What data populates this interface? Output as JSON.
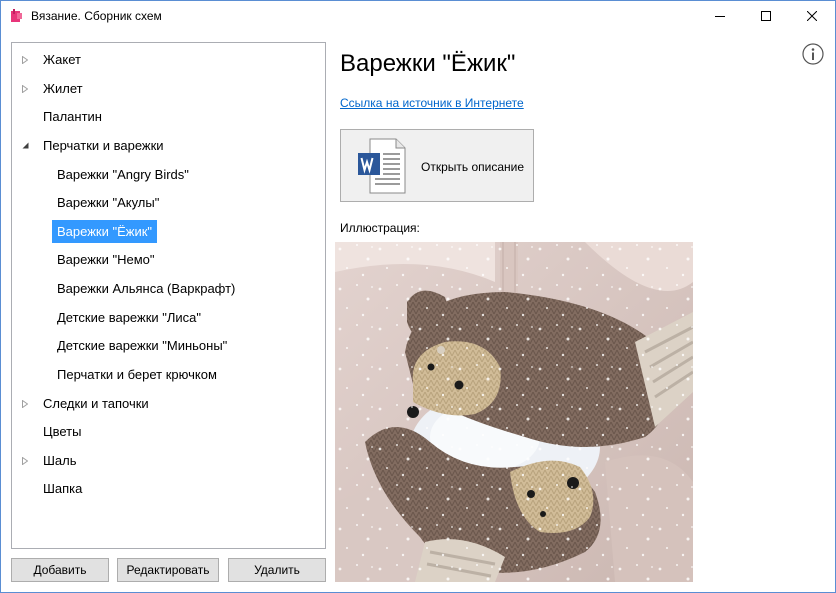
{
  "window": {
    "title": "Вязание. Сборник схем",
    "controls": [
      "minimize",
      "maximize",
      "close"
    ]
  },
  "tree": {
    "items": [
      {
        "label": "Жакет",
        "expandable": true,
        "expanded": false,
        "level": 0
      },
      {
        "label": "Жилет",
        "expandable": true,
        "expanded": false,
        "level": 0
      },
      {
        "label": "Палантин",
        "expandable": false,
        "level": 0
      },
      {
        "label": "Перчатки и варежки",
        "expandable": true,
        "expanded": true,
        "level": 0
      },
      {
        "label": "Варежки \"Angry Birds\"",
        "level": 1
      },
      {
        "label": "Варежки \"Акулы\"",
        "level": 1
      },
      {
        "label": "Варежки \"Ёжик\"",
        "level": 1,
        "selected": true
      },
      {
        "label": "Варежки \"Немо\"",
        "level": 1
      },
      {
        "label": "Варежки Альянса (Варкрафт)",
        "level": 1
      },
      {
        "label": "Детские варежки \"Лиса\"",
        "level": 1
      },
      {
        "label": "Детские варежки \"Миньоны\"",
        "level": 1
      },
      {
        "label": "Перчатки и берет крючком",
        "level": 1
      },
      {
        "label": "Следки и тапочки",
        "expandable": true,
        "expanded": false,
        "level": 0
      },
      {
        "label": "Цветы",
        "expandable": false,
        "level": 0
      },
      {
        "label": "Шаль",
        "expandable": true,
        "expanded": false,
        "level": 0
      },
      {
        "label": "Шапка",
        "expandable": false,
        "level": 0
      }
    ]
  },
  "buttons": {
    "add": "Добавить",
    "edit": "Редактировать",
    "delete": "Удалить"
  },
  "details": {
    "title": "Варежки \"Ёжик\"",
    "source_link": "Ссылка на источник в Интернете",
    "open_description": "Открыть описание",
    "illustration_label": "Иллюстрация:"
  },
  "icons": {
    "app": "app-icon",
    "info": "info-icon",
    "document": "word-document-icon"
  },
  "colors": {
    "selection": "#3399ff",
    "link": "#0066cc",
    "word_blue": "#2b579a",
    "window_border": "#5a8ed3"
  }
}
